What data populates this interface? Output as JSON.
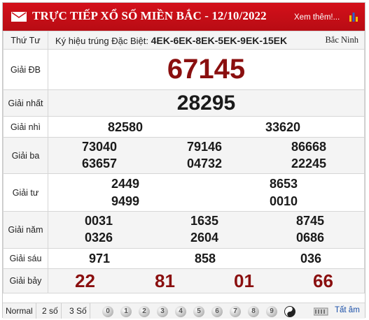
{
  "header": {
    "title": "TRỰC TIẾP XỔ SỐ MIỀN BẮC - 12/10/2022",
    "more_link": "Xem thêm!..."
  },
  "special_row": {
    "day": "Thứ Tư",
    "prefix": "Ký hiệu trúng Đặc Biệt:",
    "codes": "4EK-6EK-8EK-5EK-9EK-15EK",
    "region": "Bắc Ninh"
  },
  "prizes": {
    "db": {
      "label": "Giải ĐB",
      "numbers": [
        "67145"
      ]
    },
    "nhat": {
      "label": "Giải nhất",
      "numbers": [
        "28295"
      ]
    },
    "nhi": {
      "label": "Giải nhì",
      "numbers": [
        "82580",
        "33620"
      ]
    },
    "ba": {
      "label": "Giải ba",
      "numbers": [
        "73040",
        "79146",
        "86668",
        "63657",
        "04732",
        "22245"
      ]
    },
    "tu": {
      "label": "Giải tư",
      "numbers": [
        "2449",
        "8653",
        "9499",
        "0010"
      ]
    },
    "nam": {
      "label": "Giải năm",
      "numbers": [
        "0031",
        "1635",
        "8745",
        "0326",
        "2604",
        "0686"
      ]
    },
    "sau": {
      "label": "Giải sáu",
      "numbers": [
        "971",
        "858",
        "036"
      ]
    },
    "bay": {
      "label": "Giải bảy",
      "numbers": [
        "22",
        "81",
        "01",
        "66"
      ]
    }
  },
  "footer": {
    "tabs": [
      "Normal",
      "2 số",
      "3 Số"
    ],
    "digits": [
      "0",
      "1",
      "2",
      "3",
      "4",
      "5",
      "6",
      "7",
      "8",
      "9"
    ],
    "all_label": "Tất âm"
  },
  "colors": {
    "header_red": "#c8101a",
    "prize_red": "#8a0f0f",
    "link_blue": "#1a4fa8"
  }
}
